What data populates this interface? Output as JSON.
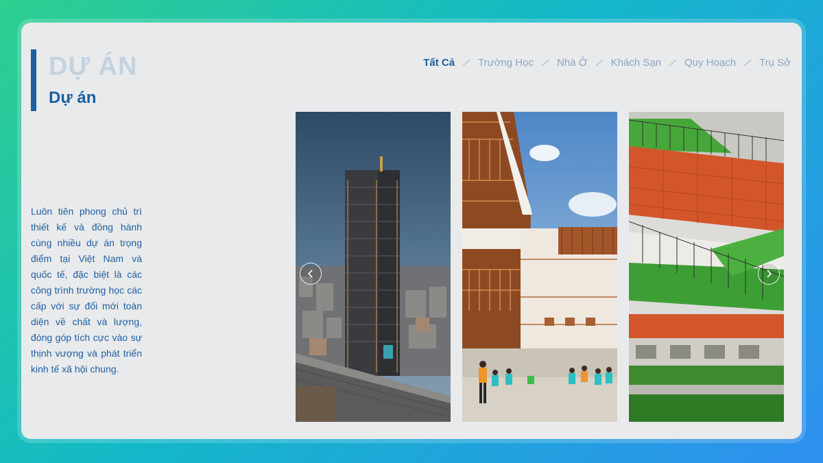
{
  "header": {
    "title_ghost": "DỰ ÁN",
    "title": "Dự án"
  },
  "filters": [
    {
      "label": "Tất Cả",
      "active": true
    },
    {
      "label": "Trường Học",
      "active": false
    },
    {
      "label": "Nhà Ở",
      "active": false
    },
    {
      "label": "Khách Sạn",
      "active": false
    },
    {
      "label": "Quy Hoạch",
      "active": false
    },
    {
      "label": "Trụ Sở",
      "active": false
    }
  ],
  "description": "Luôn tiên phong chủ trì thiết kế và đồng hành cùng nhiều dự án trọng điểm tại Việt Nam và quốc tế, đặc biệt là các công trình trường học các cấp với sự đổi mới toàn diện về chất và lượng, đóng góp tích cực vào sự thịnh vượng và phát triển kinh tế xã hội chung.",
  "gallery": {
    "prev_icon": "chevron-left-icon",
    "next_icon": "chevron-right-icon"
  },
  "colors": {
    "accent": "#1d5fa0",
    "ghost_title": "#c4d2df",
    "filter_inactive": "#8aa6c1",
    "card_bg": "#e9eaec"
  }
}
